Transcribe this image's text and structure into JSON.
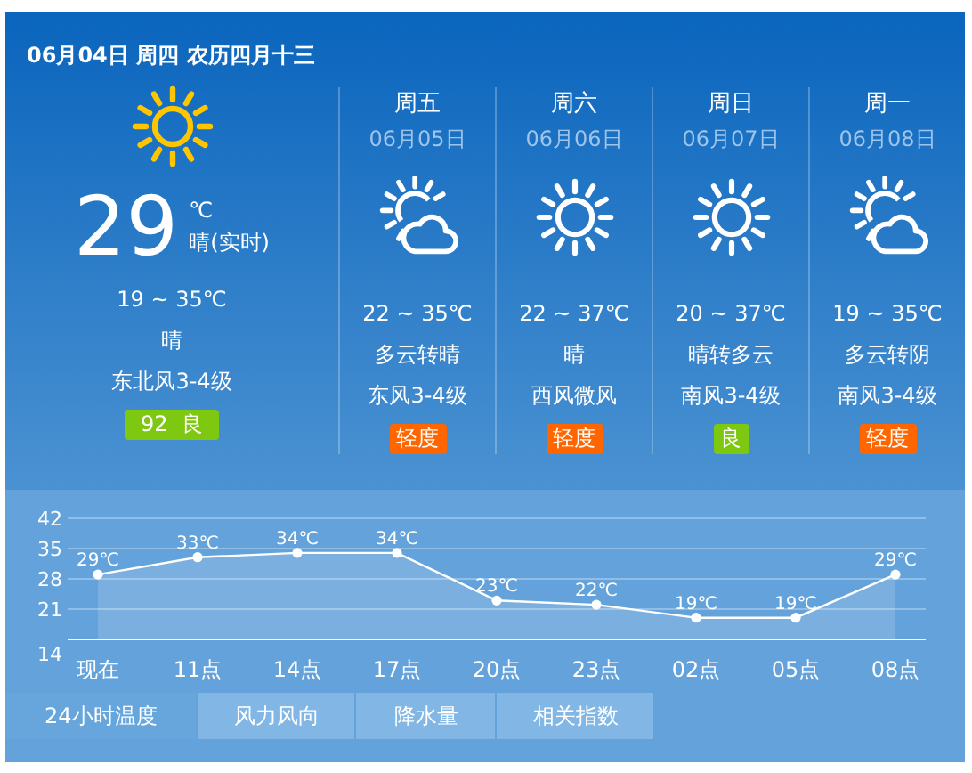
{
  "header": {
    "date_line": "06月04日 周四 农历四月十三"
  },
  "current": {
    "kind": "sunny",
    "temperature": "29",
    "unit": "℃",
    "condition_now": "晴(实时)",
    "range": "19 ~ 35℃",
    "condition": "晴",
    "wind": "东北风3-4级",
    "aqi": {
      "label": "92  良",
      "color": "#7ec811"
    }
  },
  "days": [
    {
      "weekday": "周五",
      "date": "06月05日",
      "kind": "partly-cloudy",
      "range": "22 ~ 35℃",
      "condition": "多云转晴",
      "wind": "东风3-4级",
      "aqi": {
        "label": "轻度",
        "color": "#ff6600"
      }
    },
    {
      "weekday": "周六",
      "date": "06月06日",
      "kind": "sunny",
      "range": "22 ~ 37℃",
      "condition": "晴",
      "wind": "西风微风",
      "aqi": {
        "label": "轻度",
        "color": "#ff6600"
      }
    },
    {
      "weekday": "周日",
      "date": "06月07日",
      "kind": "sunny",
      "range": "20 ~ 37℃",
      "condition": "晴转多云",
      "wind": "南风3-4级",
      "aqi": {
        "label": "良",
        "color": "#7ec811"
      }
    },
    {
      "weekday": "周一",
      "date": "06月08日",
      "kind": "partly-cloudy",
      "range": "19 ~ 35℃",
      "condition": "多云转阴",
      "wind": "南风3-4级",
      "aqi": {
        "label": "轻度",
        "color": "#ff6600"
      }
    }
  ],
  "chart": {
    "chart_data": {
      "type": "area",
      "categories": [
        "现在",
        "11点",
        "14点",
        "17点",
        "20点",
        "23点",
        "02点",
        "05点",
        "08点"
      ],
      "series": [
        {
          "color": "#ffffff",
          "values": [
            29,
            33,
            34,
            34,
            23,
            22,
            19,
            19,
            29
          ]
        }
      ],
      "ylim": [
        14,
        42
      ],
      "grid": true,
      "yticks": [
        14,
        21,
        28,
        35,
        42
      ],
      "value_labels": [
        "29℃",
        "33℃",
        "34℃",
        "34℃",
        "23℃",
        "22℃",
        "19℃",
        "19℃",
        "29℃"
      ]
    }
  },
  "tabs": [
    {
      "label": "24小时温度",
      "selected": true
    },
    {
      "label": "风力风向",
      "selected": false
    },
    {
      "label": "降水量",
      "selected": false
    },
    {
      "label": "相关指数",
      "selected": false
    }
  ]
}
